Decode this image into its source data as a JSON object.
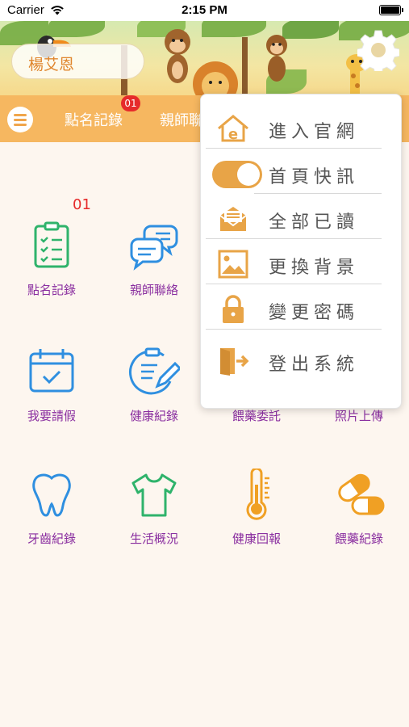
{
  "status_bar": {
    "carrier": "Carrier",
    "time": "2:15 PM"
  },
  "header": {
    "user_name": "楊艾恩"
  },
  "tabs": {
    "items": [
      {
        "label": "點名記錄"
      },
      {
        "label": "親師聯"
      }
    ],
    "badge": "01"
  },
  "grid": {
    "badge": "01",
    "items": [
      {
        "label": "點名記錄",
        "icon": "attendance-clipboard-icon"
      },
      {
        "label": "親師聯絡",
        "icon": "chat-bubbles-icon"
      },
      {
        "label": "我要請假",
        "icon": "calendar-check-icon"
      },
      {
        "label": "健康紀錄",
        "icon": "health-record-icon"
      },
      {
        "label": "餵藥委託",
        "icon": "medicine-request-icon"
      },
      {
        "label": "照片上傳",
        "icon": "photo-upload-icon"
      },
      {
        "label": "牙齒紀錄",
        "icon": "tooth-icon"
      },
      {
        "label": "生活概況",
        "icon": "tshirt-icon"
      },
      {
        "label": "健康回報",
        "icon": "thermometer-icon"
      },
      {
        "label": "餵藥紀錄",
        "icon": "capsule-icon"
      }
    ]
  },
  "menu": {
    "items": [
      {
        "label": "進入官網",
        "icon": "home-e-icon"
      },
      {
        "label": "首頁快訊",
        "icon": "toggle-switch"
      },
      {
        "label": "全部已讀",
        "icon": "mail-open-icon"
      },
      {
        "label": "更換背景",
        "icon": "image-icon"
      },
      {
        "label": "變更密碼",
        "icon": "lock-icon"
      },
      {
        "label": "登出系統",
        "icon": "logout-door-icon"
      }
    ],
    "toggle_on": true
  },
  "colors": {
    "accent": "#f6b760",
    "icon_orange": "#e8a447",
    "label_purple": "#8a2fa0",
    "badge_red": "#e62b2b"
  }
}
